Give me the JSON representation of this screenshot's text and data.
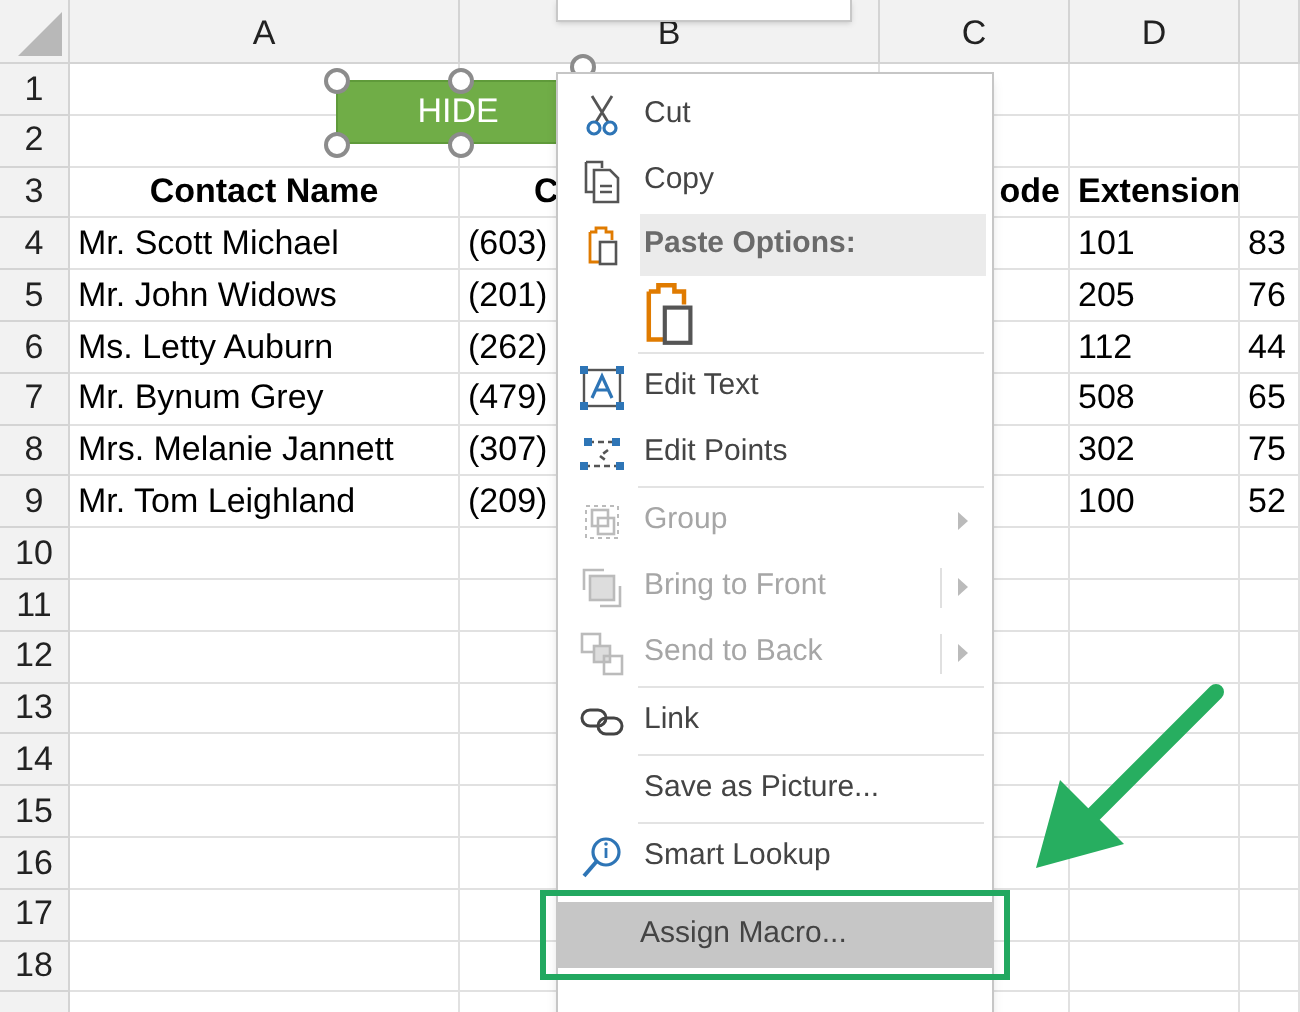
{
  "top_panel": {
    "kind": "blank"
  },
  "sheet": {
    "columns": [
      "A",
      "B",
      "C",
      "D"
    ],
    "rows": [
      {
        "number": "1"
      },
      {
        "number": "2"
      },
      {
        "number": "3",
        "kind": "header",
        "cells": {
          "A": "Contact Name",
          "B": "C",
          "C": "ode",
          "D": "Extension"
        }
      },
      {
        "number": "4",
        "kind": "data",
        "cells": {
          "A": "Mr. Scott Michael",
          "B": "(603)",
          "D": "101",
          "E": "83"
        }
      },
      {
        "number": "5",
        "kind": "data",
        "cells": {
          "A": "Mr. John Widows",
          "B": "(201)",
          "D": "205",
          "E": "76"
        }
      },
      {
        "number": "6",
        "kind": "data",
        "cells": {
          "A": "Ms. Letty Auburn",
          "B": "(262)",
          "D": "112",
          "E": "44"
        }
      },
      {
        "number": "7",
        "kind": "data",
        "cells": {
          "A": "Mr. Bynum Grey",
          "B": "(479)",
          "D": "508",
          "E": "65"
        }
      },
      {
        "number": "8",
        "kind": "data",
        "cells": {
          "A": "Mrs. Melanie Jannett",
          "B": "(307)",
          "D": "302",
          "E": "75"
        }
      },
      {
        "number": "9",
        "kind": "data",
        "cells": {
          "A": "Mr. Tom Leighland",
          "B": "(209)",
          "D": "100",
          "E": "52"
        }
      },
      {
        "number": "10"
      },
      {
        "number": "11"
      },
      {
        "number": "12"
      },
      {
        "number": "13"
      },
      {
        "number": "14"
      },
      {
        "number": "15"
      },
      {
        "number": "16"
      },
      {
        "number": "17"
      },
      {
        "number": "18"
      }
    ]
  },
  "shape_button": {
    "label": "HIDE",
    "selected": true
  },
  "context_menu": {
    "items": [
      {
        "kind": "item",
        "label": "Cut",
        "disabled": false,
        "has_submenu": false,
        "selected": false
      },
      {
        "kind": "item",
        "label": "Copy",
        "disabled": false,
        "has_submenu": false,
        "selected": false
      },
      {
        "kind": "header",
        "label": "Paste Options:"
      },
      {
        "kind": "paste_icons"
      },
      {
        "kind": "separator"
      },
      {
        "kind": "item",
        "label": "Edit Text",
        "disabled": false,
        "has_submenu": false,
        "selected": false
      },
      {
        "kind": "item",
        "label": "Edit Points",
        "disabled": false,
        "has_submenu": false,
        "selected": false
      },
      {
        "kind": "separator"
      },
      {
        "kind": "item",
        "label": "Group",
        "disabled": true,
        "has_submenu": true,
        "split": false,
        "selected": false
      },
      {
        "kind": "item",
        "label": "Bring to Front",
        "disabled": true,
        "has_submenu": true,
        "split": true,
        "selected": false
      },
      {
        "kind": "item",
        "label": "Send to Back",
        "disabled": true,
        "has_submenu": true,
        "split": true,
        "selected": false
      },
      {
        "kind": "separator"
      },
      {
        "kind": "item",
        "label": "Link",
        "disabled": false,
        "has_submenu": false,
        "selected": false
      },
      {
        "kind": "separator"
      },
      {
        "kind": "item",
        "label": "Save as Picture...",
        "disabled": false,
        "has_submenu": false,
        "selected": false
      },
      {
        "kind": "separator"
      },
      {
        "kind": "item",
        "label": "Smart Lookup",
        "disabled": false,
        "has_submenu": false,
        "selected": false
      },
      {
        "kind": "item",
        "label": "Assign Macro...",
        "disabled": false,
        "has_submenu": false,
        "selected": true
      }
    ]
  }
}
